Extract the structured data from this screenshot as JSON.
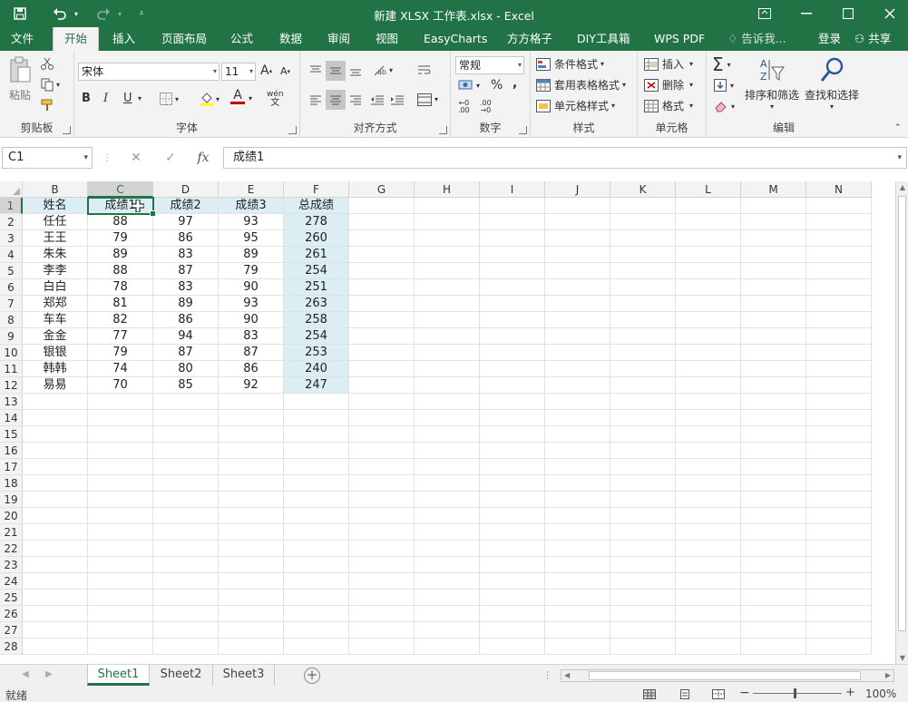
{
  "window": {
    "title": "新建 XLSX 工作表.xlsx - Excel",
    "colors": {
      "brand": "#217346",
      "header_fill": "#dbeef4"
    }
  },
  "quick_access": {
    "save_icon": "save-icon",
    "undo_icon": "undo-icon",
    "redo_icon": "redo-icon",
    "customize_icon": "customize-icon"
  },
  "tabs": [
    "文件",
    "开始",
    "插入",
    "页面布局",
    "公式",
    "数据",
    "审阅",
    "视图",
    "EasyCharts",
    "方方格子",
    "DIY工具箱",
    "WPS PDF"
  ],
  "tell_me": "告诉我...",
  "login": "登录",
  "share": "共享",
  "ribbon": {
    "clipboard": {
      "label": "剪贴板",
      "paste": "粘贴"
    },
    "font": {
      "label": "字体",
      "name": "宋体",
      "size": "11",
      "bold": "B",
      "italic": "I",
      "underline": "U",
      "font_color_letter": "A",
      "wen": "wén"
    },
    "alignment": {
      "label": "对齐方式"
    },
    "number": {
      "label": "数字",
      "format": "常规",
      "percent": "%",
      "comma": ","
    },
    "styles": {
      "label": "样式",
      "conditional": "条件格式",
      "table": "套用表格格式",
      "cell_styles": "单元格样式"
    },
    "cells": {
      "label": "单元格",
      "insert": "插入",
      "delete": "删除",
      "format": "格式"
    },
    "editing": {
      "label": "编辑",
      "sort_filter": "排序和筛选",
      "find_select": "查找和选择",
      "sigma": "Σ"
    }
  },
  "formula_bar": {
    "name_box": "C1",
    "fx": "fx",
    "content": "成绩1"
  },
  "columns": [
    "B",
    "C",
    "D",
    "E",
    "F",
    "G",
    "H",
    "I",
    "J",
    "K",
    "L",
    "M",
    "N"
  ],
  "rows": [
    "1",
    "2",
    "3",
    "4",
    "5",
    "6",
    "7",
    "8",
    "9",
    "10",
    "11",
    "12",
    "13",
    "14",
    "15",
    "16",
    "17",
    "18",
    "19",
    "20",
    "21",
    "22",
    "23",
    "24",
    "25",
    "26",
    "27",
    "28"
  ],
  "table": {
    "headers": [
      "姓名",
      "成绩1",
      "成绩2",
      "成绩3",
      "总成绩"
    ],
    "data": [
      [
        "任任",
        "88",
        "97",
        "93",
        "278"
      ],
      [
        "王王",
        "79",
        "86",
        "95",
        "260"
      ],
      [
        "朱朱",
        "89",
        "83",
        "89",
        "261"
      ],
      [
        "李李",
        "88",
        "87",
        "79",
        "254"
      ],
      [
        "白白",
        "78",
        "83",
        "90",
        "251"
      ],
      [
        "郑郑",
        "81",
        "89",
        "93",
        "263"
      ],
      [
        "车车",
        "82",
        "86",
        "90",
        "258"
      ],
      [
        "金金",
        "77",
        "94",
        "83",
        "254"
      ],
      [
        "银银",
        "79",
        "87",
        "87",
        "253"
      ],
      [
        "韩韩",
        "74",
        "80",
        "86",
        "240"
      ],
      [
        "易易",
        "70",
        "85",
        "92",
        "247"
      ]
    ]
  },
  "sheets": [
    "Sheet1",
    "Sheet2",
    "Sheet3"
  ],
  "status": {
    "ready": "就绪",
    "zoom": "100%",
    "minus": "−",
    "plus": "+"
  }
}
